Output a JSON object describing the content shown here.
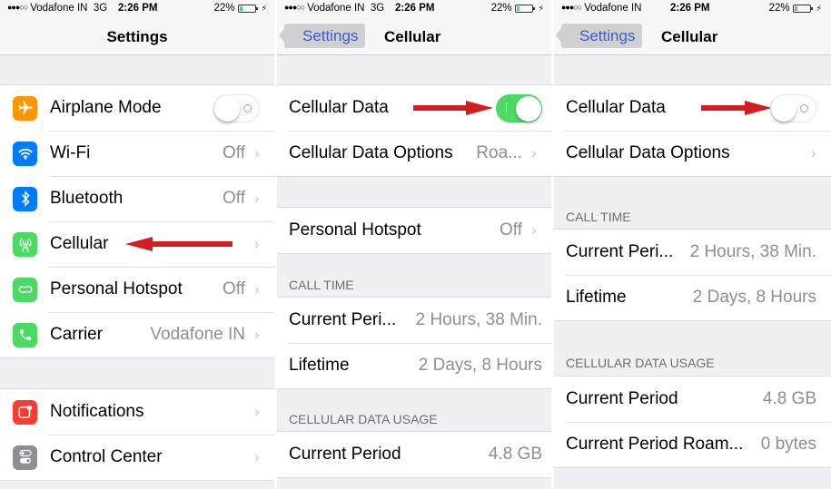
{
  "status_bar": [
    {
      "signal": "●●●○○",
      "carrier": "Vodafone IN",
      "network": "3G",
      "time": "2:26 PM",
      "battery": "22%",
      "battery_level": 0.22
    },
    {
      "signal": "●●●○○",
      "carrier": "Vodafone IN",
      "network": "3G",
      "time": "2:26 PM",
      "battery": "22%",
      "battery_level": 0.22
    },
    {
      "signal": "●●●○○",
      "carrier": "Vodafone IN",
      "network": "",
      "time": "2:26 PM",
      "battery": "22%",
      "battery_level": 0.22
    }
  ],
  "colors": {
    "toggle_on": "#4cd964",
    "annotation_arrow": "#d41d22",
    "back_link": "#3b5bc4"
  },
  "panel1": {
    "title": "Settings",
    "group1": [
      {
        "label": "Airplane Mode",
        "icon": "airplane-icon",
        "color": "#ff9500",
        "toggle": false
      },
      {
        "label": "Wi-Fi",
        "icon": "wifi-icon",
        "color": "#007aff",
        "value": "Off"
      },
      {
        "label": "Bluetooth",
        "icon": "bluetooth-icon",
        "color": "#007aff",
        "value": "Off"
      },
      {
        "label": "Cellular",
        "icon": "cellular-antenna-icon",
        "color": "#4cd964",
        "value": ""
      },
      {
        "label": "Personal Hotspot",
        "icon": "hotspot-icon",
        "color": "#4cd964",
        "value": "Off"
      },
      {
        "label": "Carrier",
        "icon": "phone-icon",
        "color": "#4cd964",
        "value": "Vodafone IN"
      }
    ],
    "group2": [
      {
        "label": "Notifications",
        "icon": "notifications-icon",
        "color": "#ff3b30"
      },
      {
        "label": "Control Center",
        "icon": "control-center-icon",
        "color": "#8e8e93"
      }
    ]
  },
  "panel2": {
    "back": "Settings",
    "title": "Cellular",
    "cellular_data": {
      "label": "Cellular Data",
      "on": true
    },
    "cellular_data_options": {
      "label": "Cellular Data Options",
      "value": "Roa..."
    },
    "hotspot": {
      "label": "Personal Hotspot",
      "value": "Off"
    },
    "call_time_header": "CALL TIME",
    "call_time": [
      {
        "label": "Current Peri...",
        "value": "2 Hours, 38 Min."
      },
      {
        "label": "Lifetime",
        "value": "2 Days, 8 Hours"
      }
    ],
    "data_usage_header": "CELLULAR DATA USAGE",
    "data_usage": [
      {
        "label": "Current Period",
        "value": "4.8 GB"
      }
    ]
  },
  "panel3": {
    "back": "Settings",
    "title": "Cellular",
    "cellular_data": {
      "label": "Cellular Data",
      "on": false
    },
    "cellular_data_options": {
      "label": "Cellular Data Options",
      "value": ""
    },
    "call_time_header": "CALL TIME",
    "call_time": [
      {
        "label": "Current Peri...",
        "value": "2 Hours, 38 Min."
      },
      {
        "label": "Lifetime",
        "value": "2 Days, 8 Hours"
      }
    ],
    "data_usage_header": "CELLULAR DATA USAGE",
    "data_usage": [
      {
        "label": "Current Period",
        "value": "4.8 GB"
      },
      {
        "label": "Current Period Roam...",
        "value": "0 bytes"
      }
    ]
  }
}
